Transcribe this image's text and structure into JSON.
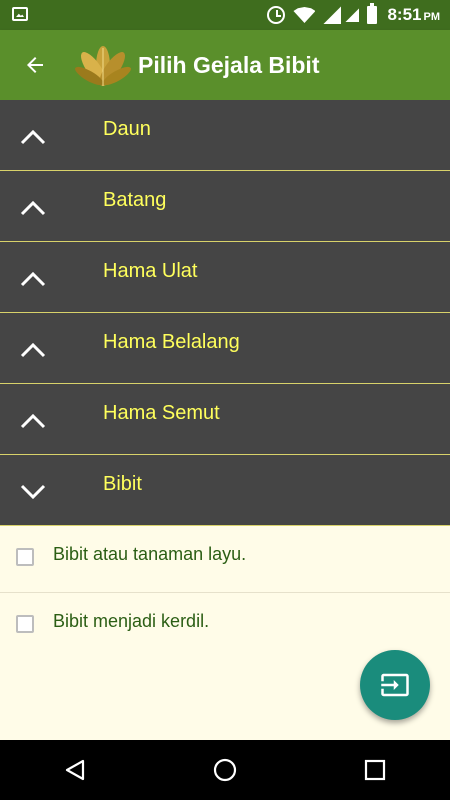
{
  "status_bar": {
    "time": "8:51",
    "ampm": "PM"
  },
  "app_bar": {
    "title": "Pilih Gejala Bibit",
    "back_icon": "arrow-left-icon"
  },
  "groups": [
    {
      "label": "Daun",
      "expanded": false
    },
    {
      "label": "Batang",
      "expanded": false
    },
    {
      "label": "Hama Ulat",
      "expanded": false
    },
    {
      "label": "Hama Belalang",
      "expanded": false
    },
    {
      "label": "Hama Semut",
      "expanded": false
    },
    {
      "label": "Bibit",
      "expanded": true
    }
  ],
  "bibit_items": [
    {
      "text": "Bibit atau tanaman layu.",
      "checked": false
    },
    {
      "text": "Bibit menjadi kerdil.",
      "checked": false
    }
  ],
  "fab": {
    "icon": "input-icon",
    "color": "#1a8c7c"
  },
  "colors": {
    "app_bar": "#5a8f2b",
    "status_bar": "#3f6d1e",
    "group_bg": "#454545",
    "group_text": "#ffff5c",
    "child_bg": "#fffce8",
    "child_text": "#2b5e14"
  }
}
